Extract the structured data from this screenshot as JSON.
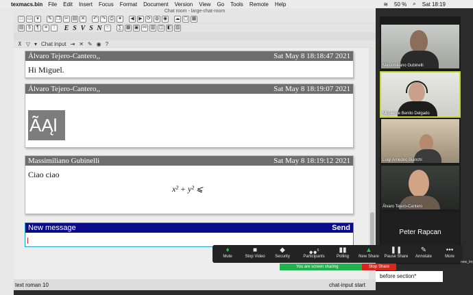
{
  "menubar": {
    "app": "texmacs.bin",
    "items": [
      "File",
      "Edit",
      "Insert",
      "Focus",
      "Format",
      "Document",
      "Version",
      "View",
      "Go",
      "Tools",
      "Remote",
      "Help"
    ],
    "battery": "50 %",
    "clock": "Sat 18:19"
  },
  "window": {
    "title": "Chat room - large-chat-room",
    "format_letters": [
      "E",
      "S",
      "V",
      "S",
      "N"
    ],
    "chat_input_label": "Chat input"
  },
  "messages": [
    {
      "author": "Álvaro Tejero-Cantero,,",
      "time": "Sat May 8 18:18:47 2021",
      "text": "Hi Miguel."
    },
    {
      "author": "Álvaro Tejero-Cantero,,",
      "time": "Sat May 8 18:19:07 2021",
      "text": "ÃĄl"
    },
    {
      "author": "Massimiliano Gubinelli",
      "time": "Sat May 8 18:19:12 2021",
      "text": "Ciao ciao",
      "formula": "x² + y² ⩽"
    }
  ],
  "new_message": {
    "label": "New message",
    "send": "Send"
  },
  "statusbar": {
    "left": "text roman 10",
    "right": "chat-input start",
    "extra": "before section*"
  },
  "participants": [
    {
      "name": "Massimiliano Gubinelli"
    },
    {
      "name": "Miguel de Benito Delgado",
      "active": true
    },
    {
      "name": "Luigi Amedeo Bianchi"
    },
    {
      "name": "Álvaro Tejero-Cantero"
    },
    {
      "name": "Peter Rapcan"
    }
  ],
  "zoom_controls": [
    {
      "label": "Mute",
      "icon": "microphone-icon"
    },
    {
      "label": "Stop Video",
      "icon": "video-camera-icon"
    },
    {
      "label": "Security",
      "icon": "shield-icon"
    },
    {
      "label": "Participants",
      "icon": "people-icon",
      "badge": "6"
    },
    {
      "label": "Polling",
      "icon": "bar-chart-icon"
    },
    {
      "label": "New Share",
      "icon": "share-arrow-icon"
    },
    {
      "label": "Pause Share",
      "icon": "pause-icon"
    },
    {
      "label": "Annotate",
      "icon": "pencil-icon"
    },
    {
      "label": "More",
      "icon": "ellipsis-icon"
    }
  ],
  "screen_share": {
    "banner": "You are screen sharing",
    "stop": "Stop Share"
  },
  "desktop": {
    "file_label": "new_tm_icon"
  },
  "colors": {
    "new_message_header": "#0a0a8c",
    "message_header": "#6e6e6e",
    "share_green": "#20b24c",
    "stop_red": "#d9261c"
  }
}
